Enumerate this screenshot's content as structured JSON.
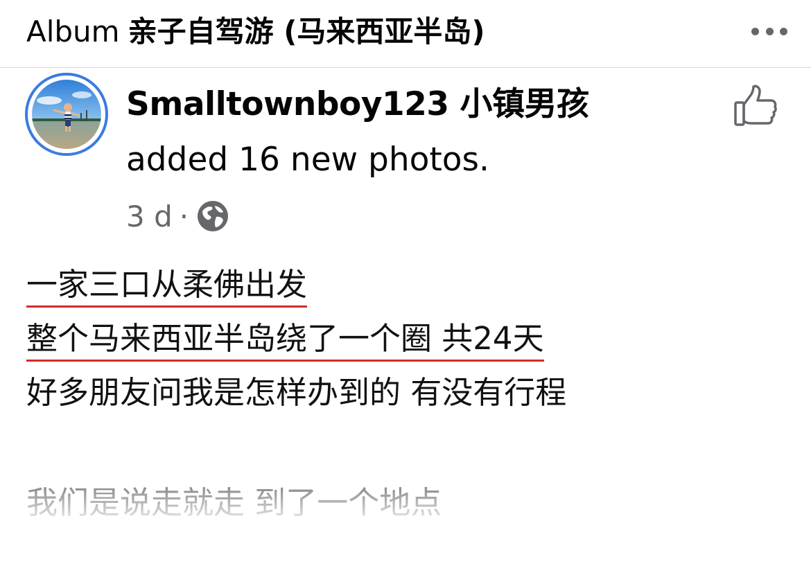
{
  "header": {
    "album_label": "Album",
    "album_name": "亲子自驾游 (马来西亚半岛)",
    "more_icon": "more-horizontal-icon"
  },
  "post": {
    "author": "Smalltownboy123 小镇男孩",
    "action": "added 16 new photos.",
    "time": "3 d",
    "separator": "·",
    "privacy_icon": "globe-icon",
    "like_icon": "thumbs-up-icon",
    "lines": [
      "一家三口从柔佛出发",
      "整个马来西亚半岛绕了一个圈 共24天",
      "好多朋友问我是怎样办到的 有没有行程"
    ],
    "faded_line": "我们是说走就走 到了一个地点"
  },
  "colors": {
    "avatar_ring": "#3b7be0",
    "underline": "#d32a2a",
    "secondary_text": "#65676b"
  }
}
